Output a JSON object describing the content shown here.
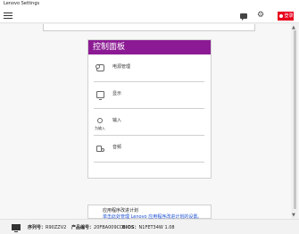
{
  "window": {
    "title": "Lenovo Settings"
  },
  "appbar": {
    "chat_icon": "chat-icon",
    "gear_icon": "gear-icon",
    "login_label": "登录"
  },
  "panel": {
    "header": "控制面板",
    "items": [
      {
        "label": "电源管理",
        "sub": "",
        "icon": "power-icon"
      },
      {
        "label": "显示",
        "sub": "",
        "icon": "display-icon"
      },
      {
        "label": "输入",
        "sub": "为输入",
        "icon": "input-icon"
      },
      {
        "label": "音频",
        "sub": "",
        "icon": "audio-icon"
      }
    ]
  },
  "improve": {
    "title": "应用程序改进计划",
    "link": "单击此处管理 Lenovo 应用程序改进计划的设置。"
  },
  "statusbar": {
    "serial_label": "序列号：",
    "serial_value": "R90ZZV2",
    "product_label": "产品编号：",
    "product_value": "20FBA009CD",
    "bios_label": "BIOS：",
    "bios_value": "N1FET34W 1.08"
  }
}
